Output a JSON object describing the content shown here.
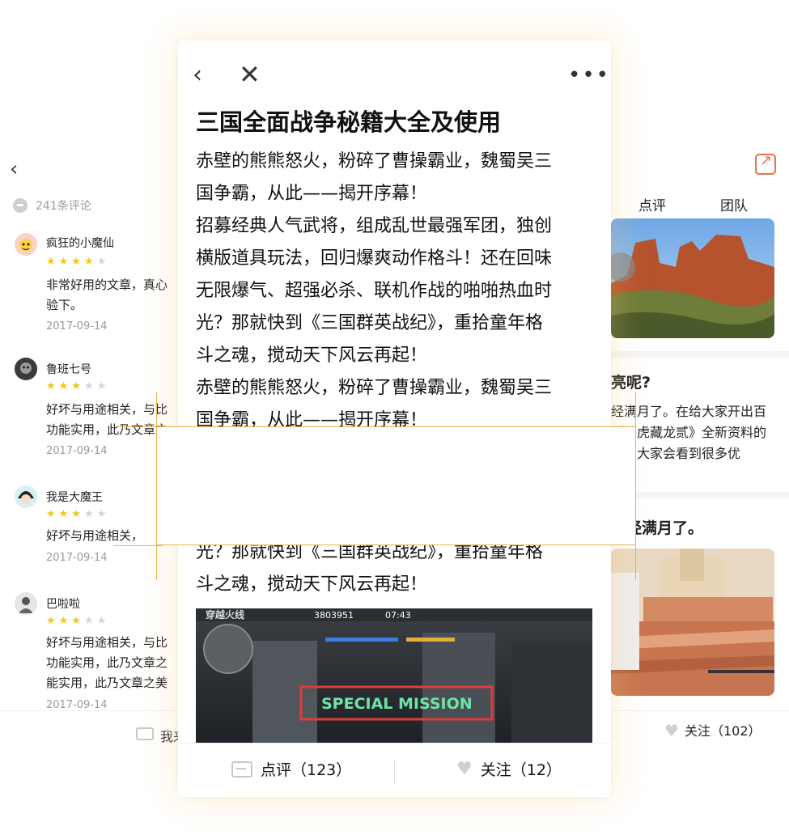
{
  "left_screen": {
    "comment_count": "241条评论",
    "reviews": [
      {
        "name": "疯狂的小魔仙",
        "rating": 4,
        "lines": [
          "非常好用的文章，真心",
          "验下。"
        ],
        "date": "2017-09-14"
      },
      {
        "name": "鲁班七号",
        "rating": 3,
        "lines": [
          "好坏与用途相关，与比",
          "功能实用，此乃文章之"
        ],
        "date": "2017-09-14"
      },
      {
        "name": "我是大魔王",
        "rating": 3,
        "lines": [
          "好坏与用途相关，"
        ],
        "date": "2017-09-14"
      },
      {
        "name": "巴啦啦",
        "rating": 3,
        "lines": [
          "好坏与用途相关，与比",
          "功能实用，此乃文章之",
          "能实用，此乃文章之美"
        ],
        "date": "2017-09-14"
      }
    ],
    "bottom_label": "我来"
  },
  "right_screen": {
    "tabs": [
      "点评",
      "团队"
    ],
    "heading1": "亮呢?",
    "para_lines": [
      "经满月了。在给大家开出百",
      "《卧虎藏龙贰》全新资料的",
      "本中大家会看到很多优"
    ],
    "heading2": "已经满月了。",
    "follow_label": "关注（102）"
  },
  "card": {
    "title": "三国全面战争秘籍大全及使用",
    "body_lines": [
      "赤壁的熊熊怒火，粉碎了曹操霸业，魏蜀吴三",
      "国争霸，从此——揭开序幕！",
      "招募经典人气武将，组成乱世最强军团，独创",
      "横版道具玩法，回归爆爽动作格斗！还在回味",
      "无限爆气、超强必杀、联机作战的啪啪热血时",
      "光？那就快到《三国群英战纪》，重拾童年格",
      "斗之魂，搅动天下风云再起！",
      "赤壁的熊熊怒火，粉碎了曹操霸业，魏蜀吴三",
      "国争霸，从此——揭开序幕！"
    ],
    "tail_lines": [
      "光？那就快到《三国群英战纪》，重拾童年格",
      "斗之魂，搅动天下风云再起！"
    ],
    "game_banner": {
      "logo": "穿越火线",
      "score": "3803951",
      "timer": "07:43",
      "mission_text": "SPECIAL MISSION"
    },
    "review_label": "点评（123）",
    "follow_label": "关注（12）"
  }
}
